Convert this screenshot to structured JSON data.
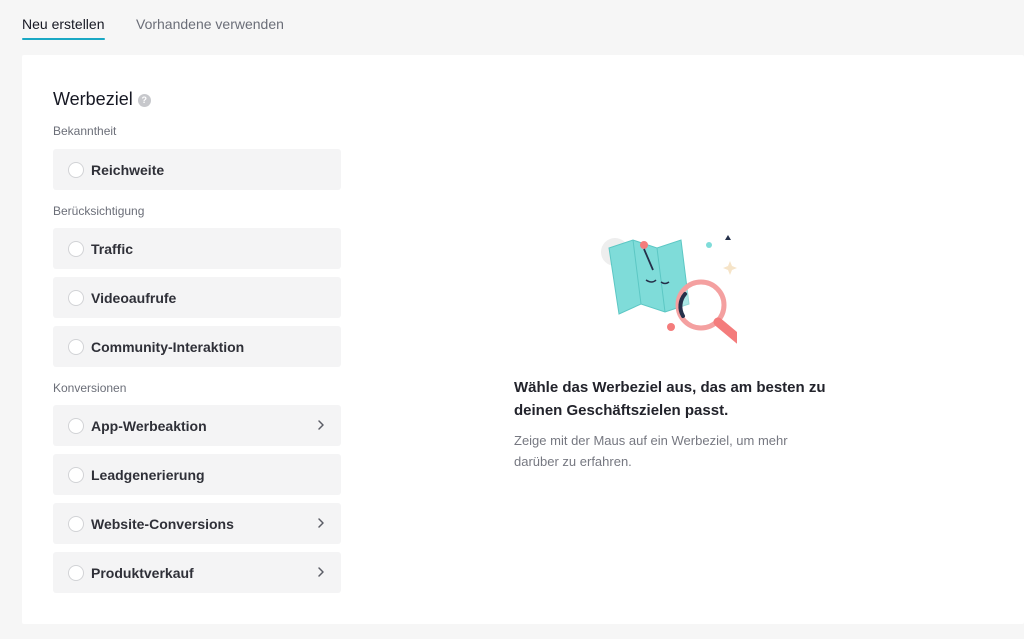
{
  "tabs": [
    {
      "label": "Neu erstellen",
      "active": true
    },
    {
      "label": "Vorhandene verwenden",
      "active": false
    }
  ],
  "panel": {
    "title": "Werbeziel",
    "help_icon": "question-mark-icon",
    "sections": [
      {
        "label": "Bekanntheit",
        "options": [
          {
            "label": "Reichweite",
            "has_chevron": false
          }
        ]
      },
      {
        "label": "Berücksichtigung",
        "options": [
          {
            "label": "Traffic",
            "has_chevron": false
          },
          {
            "label": "Videoaufrufe",
            "has_chevron": false
          },
          {
            "label": "Community-Interaktion",
            "has_chevron": false
          }
        ]
      },
      {
        "label": "Konversionen",
        "options": [
          {
            "label": "App-Werbeaktion",
            "has_chevron": true
          },
          {
            "label": "Leadgenerierung",
            "has_chevron": false
          },
          {
            "label": "Website-Conversions",
            "has_chevron": true
          },
          {
            "label": "Produktverkauf",
            "has_chevron": true
          }
        ]
      }
    ]
  },
  "empty_state": {
    "illustration": "map-magnifier-illustration",
    "headline": "Wähle das Werbeziel aus, das am besten zu deinen Geschäftszielen passt.",
    "subtext": "Zeige mit der Maus auf ein Werbeziel, um mehr darüber zu erfahren."
  },
  "colors": {
    "accent": "#1aa8c4",
    "option_bg": "#f4f4f5",
    "map": "#7fdcd9",
    "pin": "#f47c7c",
    "navy": "#25304a"
  }
}
